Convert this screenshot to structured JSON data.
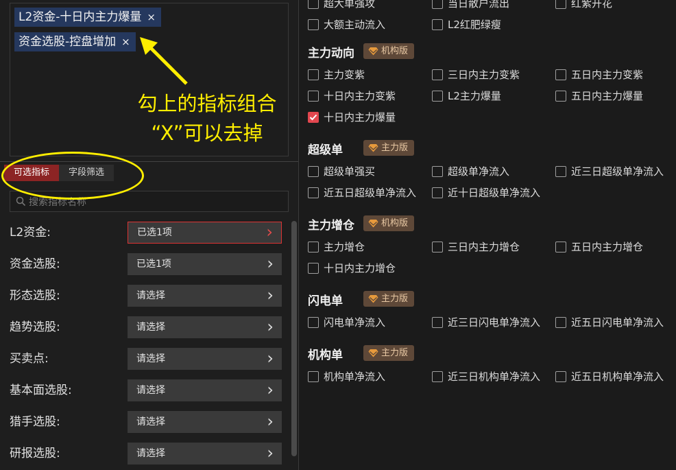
{
  "chips": [
    {
      "label": "L2资金-十日内主力爆量",
      "close": "×"
    },
    {
      "label": "资金选股-控盘增加",
      "close": "×"
    }
  ],
  "annotation": {
    "line1": "勾上的指标组合",
    "line2": "“X”可以去掉",
    "color": "#ffee00"
  },
  "tabs": {
    "active": "可选指标",
    "inactive": "字段筛选"
  },
  "search": {
    "placeholder": "搜索指标名称",
    "icon": "search-icon"
  },
  "categories": [
    {
      "label": "L2资金:",
      "value": "已选1项"
    },
    {
      "label": "资金选股:",
      "value": "已选1项"
    },
    {
      "label": "形态选股:",
      "value": "请选择"
    },
    {
      "label": "趋势选股:",
      "value": "请选择"
    },
    {
      "label": "买卖点:",
      "value": "请选择"
    },
    {
      "label": "基本面选股:",
      "value": "请选择"
    },
    {
      "label": "猎手选股:",
      "value": "请选择"
    },
    {
      "label": "研报选股:",
      "value": "请选择"
    }
  ],
  "top_rows": [
    [
      "超大单强攻",
      "当日散户流出",
      "红紫开花"
    ],
    [
      "大额主动流入",
      "L2红肥绿瘦"
    ]
  ],
  "sections": [
    {
      "title": "主力动向",
      "badge": "机构版",
      "rows": [
        [
          {
            "label": "主力变紫"
          },
          {
            "label": "三日内主力变紫"
          },
          {
            "label": "五日内主力变紫"
          }
        ],
        [
          {
            "label": "十日内主力变紫"
          },
          {
            "label": "L2主力爆量"
          },
          {
            "label": "五日内主力爆量"
          }
        ],
        [
          {
            "label": "十日内主力爆量",
            "checked": true
          }
        ]
      ]
    },
    {
      "title": "超级单",
      "badge": "主力版",
      "rows": [
        [
          {
            "label": "超级单强买"
          },
          {
            "label": "超级单净流入"
          },
          {
            "label": "近三日超级单净流入"
          }
        ],
        [
          {
            "label": "近五日超级单净流入"
          },
          {
            "label": "近十日超级单净流入"
          }
        ]
      ]
    },
    {
      "title": "主力增仓",
      "badge": "机构版",
      "rows": [
        [
          {
            "label": "主力增仓"
          },
          {
            "label": "三日内主力增仓"
          },
          {
            "label": "五日内主力增仓"
          }
        ],
        [
          {
            "label": "十日内主力增仓"
          }
        ]
      ]
    },
    {
      "title": "闪电单",
      "badge": "主力版",
      "rows": [
        [
          {
            "label": "闪电单净流入"
          },
          {
            "label": "近三日闪电单净流入"
          },
          {
            "label": "近五日闪电单净流入"
          }
        ]
      ]
    },
    {
      "title": "机构单",
      "badge": "主力版",
      "rows": [
        [
          {
            "label": "机构单净流入"
          },
          {
            "label": "近三日机构单净流入"
          },
          {
            "label": "近五日机构单净流入"
          }
        ]
      ]
    }
  ],
  "colors": {
    "chip_bg": "#25385e",
    "tab_active": "#8c2424",
    "checkbox_checked": "#e2474f",
    "badge_bg": "#5e4838"
  }
}
